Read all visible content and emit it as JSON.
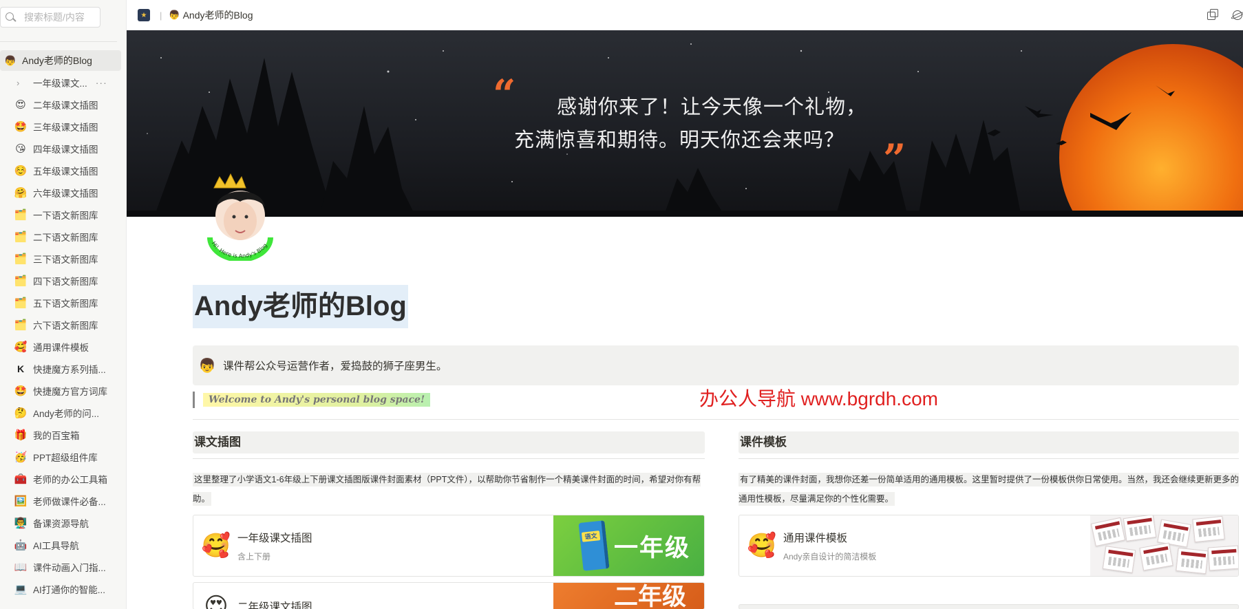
{
  "sidebar": {
    "search_placeholder": "搜索标题/内容",
    "root": {
      "emoji": "👦",
      "label": "Andy老师的Blog"
    },
    "items": [
      {
        "emoji": "",
        "label": "一年级课文...",
        "child": true
      },
      {
        "emoji": "😍",
        "label": "二年级课文插图"
      },
      {
        "emoji": "🤩",
        "label": "三年级课文插图"
      },
      {
        "emoji": "😘",
        "label": "四年级课文插图"
      },
      {
        "emoji": "☺️",
        "label": "五年级课文插图"
      },
      {
        "emoji": "🤗",
        "label": "六年级课文插图"
      },
      {
        "emoji": "🗂️",
        "label": "一下语文新图库"
      },
      {
        "emoji": "🗂️",
        "label": "二下语文新图库"
      },
      {
        "emoji": "🗂️",
        "label": "三下语文新图库"
      },
      {
        "emoji": "🗂️",
        "label": "四下语文新图库"
      },
      {
        "emoji": "🗂️",
        "label": "五下语文新图库"
      },
      {
        "emoji": "🗂️",
        "label": "六下语文新图库"
      },
      {
        "emoji": "🥰",
        "label": "通用课件模板"
      },
      {
        "emoji": "K",
        "label": "快捷魔方系列插..."
      },
      {
        "emoji": "🤩",
        "label": "快捷魔方官方词库"
      },
      {
        "emoji": "🤔",
        "label": "Andy老师的问..."
      },
      {
        "emoji": "🎁",
        "label": "我的百宝箱"
      },
      {
        "emoji": "🥳",
        "label": "PPT超级组件库"
      },
      {
        "emoji": "🧰",
        "label": "老师的办公工具箱"
      },
      {
        "emoji": "🖼️",
        "label": "老师做课件必备..."
      },
      {
        "emoji": "👨‍🏫",
        "label": "备课资源导航"
      },
      {
        "emoji": "🤖",
        "label": "AI工具导航"
      },
      {
        "emoji": "📖",
        "label": "课件动画入门指..."
      },
      {
        "emoji": "💻",
        "label": "AI打通你的智能..."
      }
    ]
  },
  "topbar": {
    "crumb_emoji": "👦",
    "crumb": "Andy老师的Blog"
  },
  "banner": {
    "quote_line1": "感谢你来了！让今天像一个礼物，",
    "quote_line2": "充满惊喜和期待。明天你还会来吗？",
    "quote_open": "“",
    "quote_close": "”"
  },
  "avatar": {
    "ring_text": "Hi！Here is Andy's Blog"
  },
  "page": {
    "title": "Andy老师的Blog",
    "callout_emoji": "👦",
    "callout_text": "课件帮公众号运营作者，爱捣鼓的狮子座男生。",
    "quote": "Welcome to Andy's personal blog space!",
    "watermark": "办公人导航 www.bgrdh.com"
  },
  "left_column": {
    "heading": "课文插图",
    "description": "这里整理了小学语文1-6年级上下册课文插图版课件封面素材（PPT文件），以帮助你节省制作一个精美课件封面的时间，希望对你有帮助。",
    "cards": [
      {
        "emoji": "🥰",
        "title": "一年级课文插图",
        "subtitle": "含上下册",
        "thumb_label": "一年级",
        "book_label": "语文"
      },
      {
        "emoji": "😍",
        "title": "二年级课文插图",
        "subtitle": "",
        "thumb_label": "二年级"
      }
    ]
  },
  "right_column": {
    "heading": "课件模板",
    "description": "有了精美的课件封面，我想你还差一份简单适用的通用模板。这里暂时提供了一份模板供你日常使用。当然，我还会继续更新更多的通用性模板，尽量满足你的个性化需要。",
    "cards": [
      {
        "emoji": "🥰",
        "title": "通用课件模板",
        "subtitle": "Andy亲自设计的简洁模板"
      }
    ]
  },
  "colors": {
    "accent_orange": "#ef6a2f",
    "watermark_red": "#e02020",
    "title_highlight": "#e3eef8"
  }
}
